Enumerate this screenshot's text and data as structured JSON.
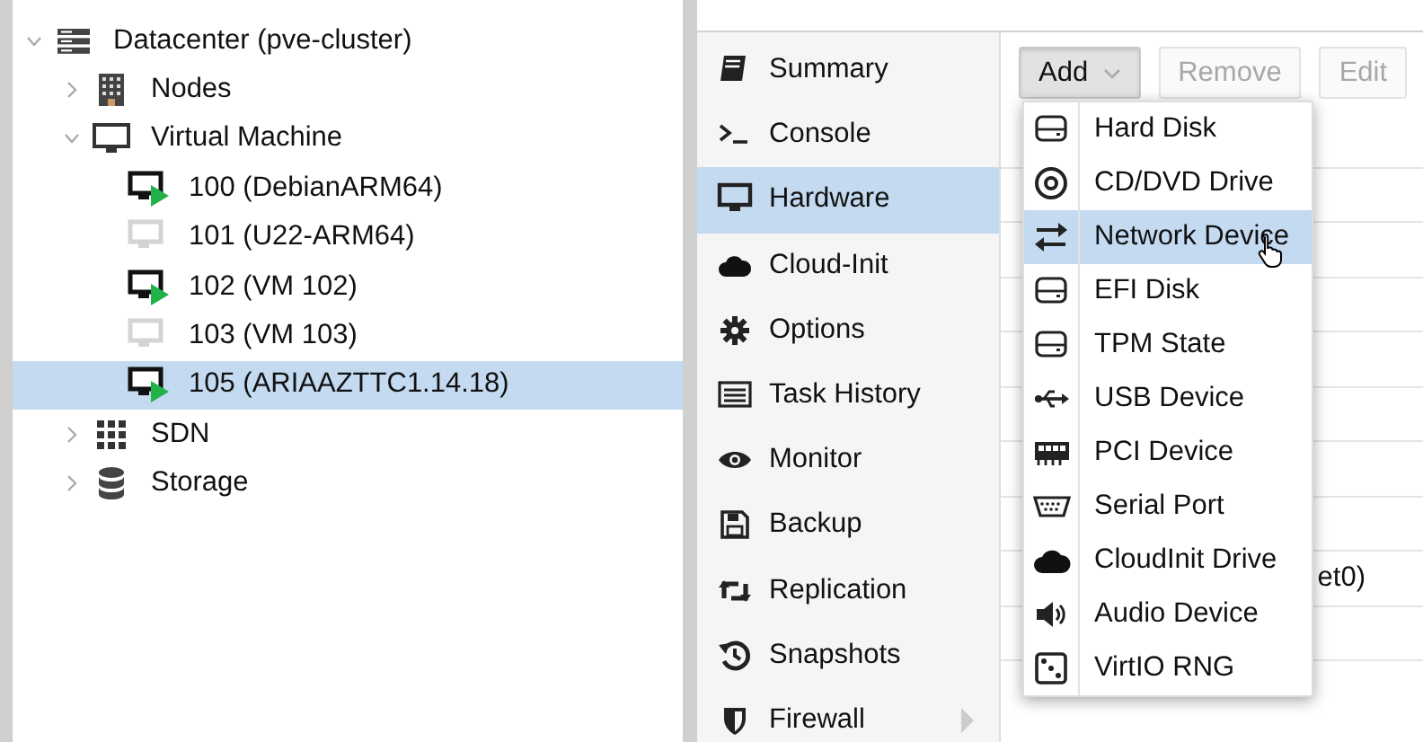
{
  "resource_tree": [
    {
      "label": "Datacenter (pve-cluster)",
      "kind": "datacenter",
      "expanded": true,
      "selected": false,
      "children": [
        {
          "label": "Nodes",
          "kind": "nodes",
          "expanded": false,
          "selected": false
        },
        {
          "label": "Virtual Machine",
          "kind": "vmgroup",
          "expanded": true,
          "selected": false,
          "children": [
            {
              "label": "100 (DebianARM64)",
              "kind": "vm",
              "running": true,
              "selected": false
            },
            {
              "label": "101 (U22-ARM64)",
              "kind": "vm",
              "running": false,
              "selected": false
            },
            {
              "label": "102 (VM 102)",
              "kind": "vm",
              "running": true,
              "selected": false
            },
            {
              "label": "103 (VM 103)",
              "kind": "vm",
              "running": false,
              "selected": false
            },
            {
              "label": "105 (ARIAAZTTC1.14.18)",
              "kind": "vm",
              "running": true,
              "selected": true
            }
          ]
        },
        {
          "label": "SDN",
          "kind": "sdn",
          "expanded": false,
          "selected": false
        },
        {
          "label": "Storage",
          "kind": "storage",
          "expanded": false,
          "selected": false
        }
      ]
    }
  ],
  "vm_nav": [
    {
      "label": "Summary",
      "kind": "book",
      "selected": false,
      "submenu": false
    },
    {
      "label": "Console",
      "kind": "terminal",
      "selected": false,
      "submenu": false
    },
    {
      "label": "Hardware",
      "kind": "desktop",
      "selected": true,
      "submenu": false
    },
    {
      "label": "Cloud-Init",
      "kind": "cloud",
      "selected": false,
      "submenu": false
    },
    {
      "label": "Options",
      "kind": "gear",
      "selected": false,
      "submenu": false
    },
    {
      "label": "Task History",
      "kind": "list",
      "selected": false,
      "submenu": false
    },
    {
      "label": "Monitor",
      "kind": "eye",
      "selected": false,
      "submenu": false
    },
    {
      "label": "Backup",
      "kind": "floppy",
      "selected": false,
      "submenu": false
    },
    {
      "label": "Replication",
      "kind": "retweet",
      "selected": false,
      "submenu": false
    },
    {
      "label": "Snapshots",
      "kind": "history",
      "selected": false,
      "submenu": false
    },
    {
      "label": "Firewall",
      "kind": "shield",
      "selected": false,
      "submenu": true
    }
  ],
  "toolbar": [
    {
      "label": "Add",
      "kind": "menu",
      "disabled": false,
      "pressed": true
    },
    {
      "label": "Remove",
      "kind": "plain",
      "disabled": true,
      "pressed": false
    },
    {
      "label": "Edit",
      "kind": "plain",
      "disabled": true,
      "pressed": false
    }
  ],
  "add_menu": [
    {
      "label": "Hard Disk",
      "kind": "disk",
      "selected": false
    },
    {
      "label": "CD/DVD Drive",
      "kind": "cdrom",
      "selected": false
    },
    {
      "label": "Network Device",
      "kind": "exchange",
      "selected": true
    },
    {
      "label": "EFI Disk",
      "kind": "disk",
      "selected": false
    },
    {
      "label": "TPM State",
      "kind": "disk",
      "selected": false
    },
    {
      "label": "USB Device",
      "kind": "usb",
      "selected": false
    },
    {
      "label": "PCI Device",
      "kind": "pci",
      "selected": false
    },
    {
      "label": "Serial Port",
      "kind": "serial",
      "selected": false
    },
    {
      "label": "CloudInit Drive",
      "kind": "cloud",
      "selected": false
    },
    {
      "label": "Audio Device",
      "kind": "speaker",
      "selected": false
    },
    {
      "label": "VirtIO RNG",
      "kind": "dice",
      "selected": false
    }
  ],
  "hardware_grid": {
    "visible_text": "et0)"
  }
}
